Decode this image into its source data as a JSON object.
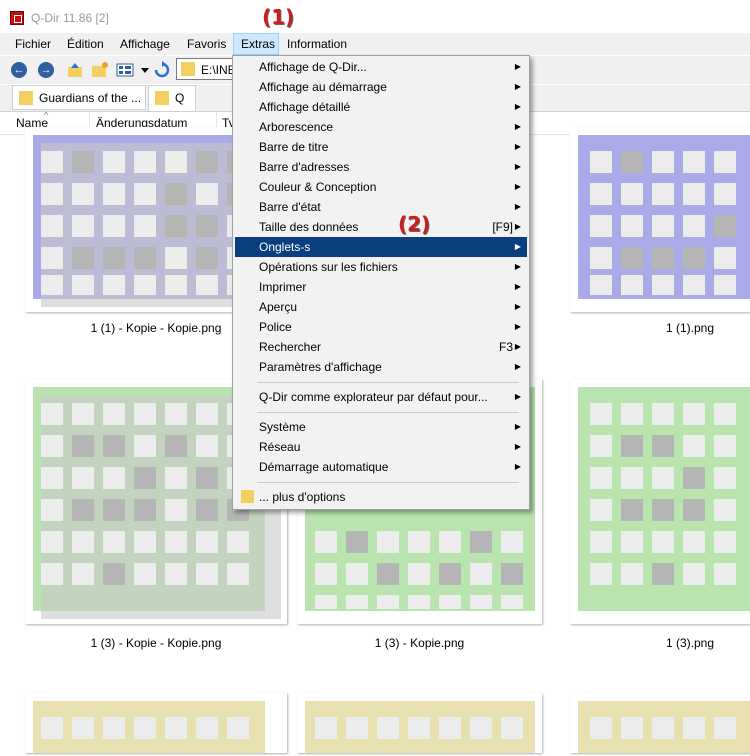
{
  "window": {
    "title": "Q-Dir 11.86 [2]"
  },
  "annotations": {
    "one": "(1)",
    "two": "(2)"
  },
  "menubar": {
    "items": [
      "Fichier",
      "Édition",
      "Affichage",
      "Favoris",
      "Extras",
      "Information"
    ]
  },
  "address": {
    "value": "E:\\INE"
  },
  "tabs": [
    {
      "label": "Guardians of the ..."
    },
    {
      "label": "Q"
    }
  ],
  "columns": {
    "name": "Name",
    "date": "Änderungsdatum",
    "type": "Ty"
  },
  "files": [
    {
      "caption": "1 (1) - Kopie - Kopie.png"
    },
    {
      "caption": "1 (1).png"
    },
    {
      "caption": "1 (3) - Kopie - Kopie.png"
    },
    {
      "caption": "1 (3) - Kopie.png"
    },
    {
      "caption": "1 (3).png"
    }
  ],
  "colors": {
    "blue_tile_bg": "#aaaae8",
    "green_tile_bg": "#b9e4b0",
    "yellow_tile_bg": "#e8e0b0",
    "menu_highlight": "#0a3e7e",
    "annotation": "#d11a1a"
  },
  "extras_menu": {
    "items": [
      {
        "label": "Affichage de Q-Dir...",
        "submenu": true
      },
      {
        "label": "Affichage au démarrage",
        "submenu": true
      },
      {
        "label": "Affichage détaillé",
        "submenu": true
      },
      {
        "label": "Arborescence",
        "submenu": true
      },
      {
        "label": "Barre de titre",
        "submenu": true
      },
      {
        "label": "Barre d'adresses",
        "submenu": true
      },
      {
        "label": "Couleur & Conception",
        "submenu": true
      },
      {
        "label": "Barre d'état",
        "submenu": true
      },
      {
        "label": "Taille des données",
        "shortcut": "[F9]",
        "submenu": true
      },
      {
        "label": "Onglets-s",
        "submenu": true,
        "highlighted": true
      },
      {
        "label": "Opérations sur les fichiers",
        "submenu": true
      },
      {
        "label": "Imprimer",
        "submenu": true
      },
      {
        "label": "Aperçu",
        "submenu": true
      },
      {
        "label": "Police",
        "submenu": true
      },
      {
        "label": "Rechercher",
        "shortcut": "F3",
        "submenu": true
      },
      {
        "label": "Paramètres d'affichage",
        "submenu": true
      },
      {
        "label": "Q-Dir comme explorateur par défaut pour...",
        "submenu": true
      },
      {
        "label": "Système",
        "submenu": true
      },
      {
        "label": "Réseau",
        "submenu": true
      },
      {
        "label": "Démarrage automatique",
        "submenu": true
      },
      {
        "label": "... plus d'options",
        "submenu": false
      }
    ]
  }
}
